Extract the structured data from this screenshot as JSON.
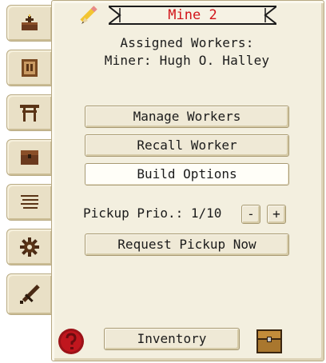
{
  "window": {
    "title": "Mine 2",
    "title_color": "#d2141a",
    "panel_color": "#f3efdf"
  },
  "tabs": [
    {
      "icon": "crown-icon"
    },
    {
      "icon": "info-book-icon"
    },
    {
      "icon": "workbench-icon"
    },
    {
      "icon": "chest-icon"
    },
    {
      "icon": "list-icon"
    },
    {
      "icon": "gear-icon"
    },
    {
      "icon": "sword-icon"
    }
  ],
  "workers": {
    "heading": "Assigned Workers:",
    "assignment": "Miner: Hugh O. Halley"
  },
  "buttons": {
    "manage_workers": "Manage Workers",
    "recall_worker": "Recall Worker",
    "build_options": "Build Options",
    "request_pickup": "Request Pickup Now",
    "inventory": "Inventory"
  },
  "pickup_priority": {
    "label": "Pickup Prio.: 1/10",
    "value": 1,
    "max": 10,
    "decrease": "-",
    "increase": "+"
  },
  "footer": {
    "help_icon": "help-icon",
    "chest_icon": "chest-icon"
  }
}
